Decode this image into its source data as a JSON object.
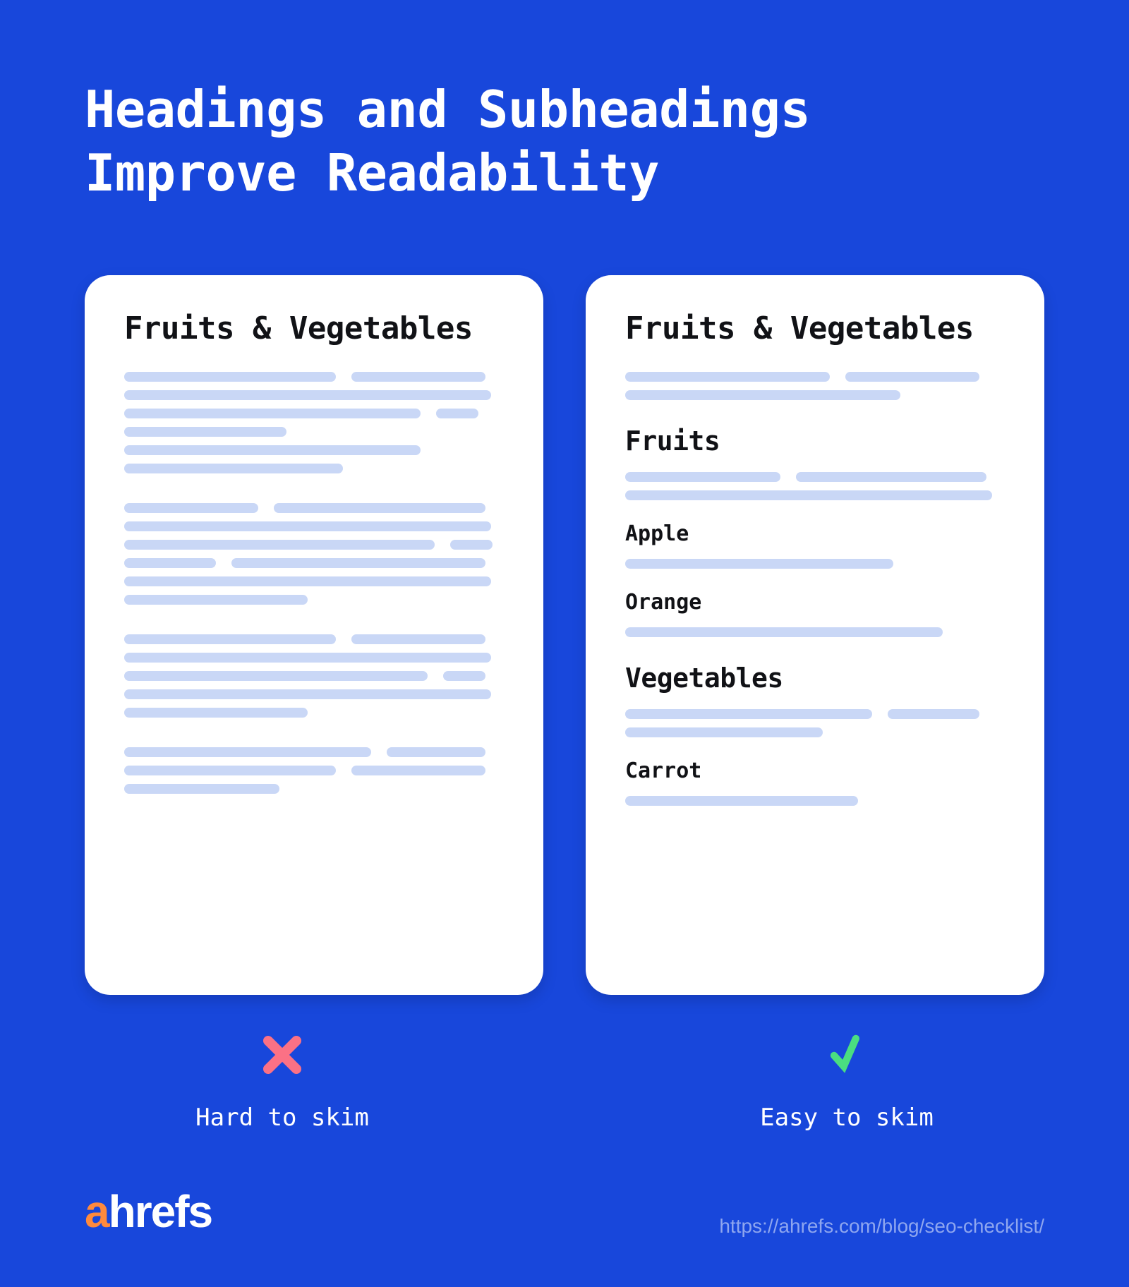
{
  "title": "Headings and Subheadings\nImprove Readability",
  "colors": {
    "background": "#1847db",
    "card_bg": "#ffffff",
    "placeholder_line": "#c9d7f6",
    "text_dark": "#111216",
    "cross": "#fb7185",
    "check": "#4ade80",
    "brand_accent": "#ff8a3d",
    "url": "#8ea6ef"
  },
  "left_card": {
    "title": "Fruits & Vegetables"
  },
  "right_card": {
    "title": "Fruits & Vegetables",
    "h2_a": "Fruits",
    "h3_a1": "Apple",
    "h3_a2": "Orange",
    "h2_b": "Vegetables",
    "h3_b1": "Carrot"
  },
  "status": {
    "left": "Hard to skim",
    "right": "Easy to skim"
  },
  "footer": {
    "brand_a": "a",
    "brand_rest": "hrefs",
    "url": "https://ahrefs.com/blog/seo-checklist/"
  }
}
